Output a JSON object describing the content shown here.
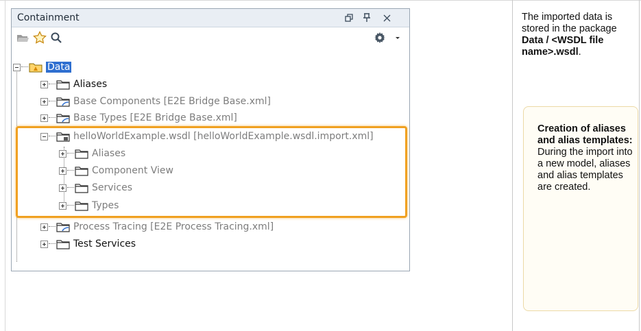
{
  "panel": {
    "title": "Containment"
  },
  "icons": {
    "restore": "restore-icon",
    "pin": "pin-icon",
    "close": "close-icon",
    "open": "open-folder-icon",
    "favorite": "star-icon",
    "search": "search-icon",
    "settings": "gear-icon",
    "menu": "dropdown-arrow-icon"
  },
  "tree": {
    "root": "Data",
    "items": [
      "Aliases",
      "Base Components [E2E Bridge Base.xml]",
      "Base Types [E2E Bridge Base.xml]",
      "helloWorldExample.wsdl [helloWorldExample.wsdl.import.xml]",
      "Aliases",
      "Component View",
      "Services",
      "Types",
      "Process Tracing [E2E Process Tracing.xml]",
      "Test Services"
    ]
  },
  "side": {
    "intro": "The imported data is stored in the package ",
    "intro_bold": "Data / <WSDL file name>.wsdl",
    "intro_end": ".",
    "note_title": "Creation of aliases and alias templates:",
    "note_body": " During the import into a new model, aliases and alias templates are created."
  },
  "colors": {
    "selection": "#2f6fd0",
    "highlight": "#f0a020",
    "note_border": "#ecd9a6",
    "note_bg": "#fffdf5"
  }
}
